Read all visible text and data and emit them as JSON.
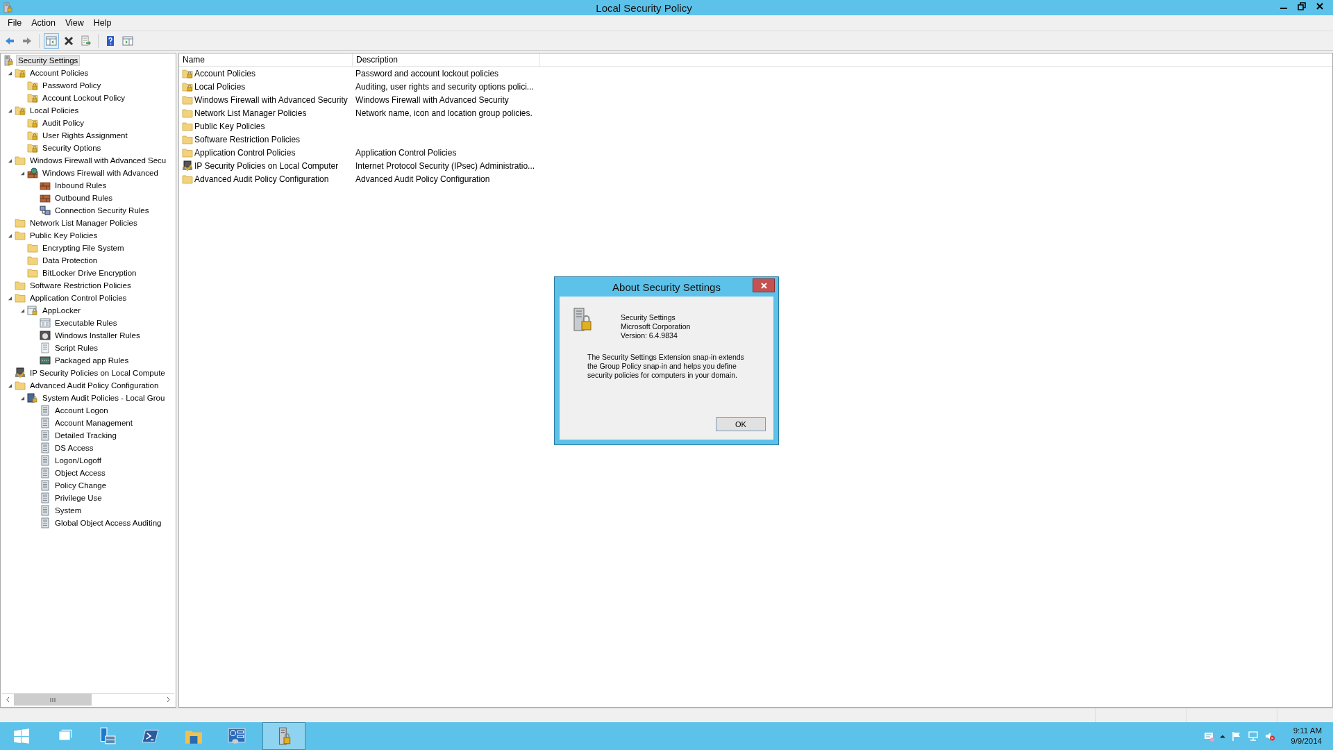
{
  "window": {
    "title": "Local Security Policy"
  },
  "menu": [
    "File",
    "Action",
    "View",
    "Help"
  ],
  "toolbar": [
    {
      "kind": "back"
    },
    {
      "kind": "forward"
    },
    {
      "kind": "pane",
      "selected": true
    },
    {
      "kind": "delete"
    },
    {
      "kind": "export"
    },
    {
      "kind": "help"
    },
    {
      "kind": "panel"
    }
  ],
  "tree": [
    {
      "label": "Security Settings",
      "kind": "root",
      "selected": true,
      "children": [
        {
          "label": "Account Policies",
          "kind": "lockfolder",
          "selected": false,
          "expanded": true,
          "children": [
            {
              "label": "Password Policy",
              "kind": "lockfolder",
              "selected": false
            },
            {
              "label": "Account Lockout Policy",
              "kind": "lockfolder",
              "selected": false
            }
          ]
        },
        {
          "label": "Local Policies",
          "kind": "lockfolder",
          "selected": false,
          "expanded": true,
          "children": [
            {
              "label": "Audit Policy",
              "kind": "lockfolder",
              "selected": false
            },
            {
              "label": "User Rights Assignment",
              "kind": "lockfolder",
              "selected": false
            },
            {
              "label": "Security Options",
              "kind": "lockfolder",
              "selected": false
            }
          ]
        },
        {
          "label": "Windows Firewall with Advanced Secu",
          "kind": "folder",
          "selected": false,
          "expanded": true,
          "children": [
            {
              "label": "Windows Firewall with Advanced",
              "kind": "firewall",
              "selected": false,
              "expanded": true,
              "children": [
                {
                  "label": "Inbound Rules",
                  "kind": "wall",
                  "selected": false
                },
                {
                  "label": "Outbound Rules",
                  "kind": "wall",
                  "selected": false
                },
                {
                  "label": "Connection Security Rules",
                  "kind": "connection",
                  "selected": false
                }
              ]
            }
          ]
        },
        {
          "label": "Network List Manager Policies",
          "kind": "folder",
          "selected": false
        },
        {
          "label": "Public Key Policies",
          "kind": "folder",
          "selected": false,
          "expanded": true,
          "children": [
            {
              "label": "Encrypting File System",
              "kind": "folder",
              "selected": false
            },
            {
              "label": "Data Protection",
              "kind": "folder",
              "selected": false
            },
            {
              "label": "BitLocker Drive Encryption",
              "kind": "folder",
              "selected": false
            }
          ]
        },
        {
          "label": "Software Restriction Policies",
          "kind": "folder",
          "selected": false
        },
        {
          "label": "Application Control Policies",
          "kind": "folder",
          "selected": false,
          "expanded": true,
          "children": [
            {
              "label": "AppLocker",
              "kind": "applocker",
              "selected": false,
              "expanded": true,
              "children": [
                {
                  "label": "Executable Rules",
                  "kind": "window",
                  "selected": false
                },
                {
                  "label": "Windows Installer Rules",
                  "kind": "installer",
                  "selected": false
                },
                {
                  "label": "Script Rules",
                  "kind": "script",
                  "selected": false
                },
                {
                  "label": "Packaged app Rules",
                  "kind": "package",
                  "selected": false
                }
              ]
            }
          ]
        },
        {
          "label": "IP Security Policies on Local Compute",
          "kind": "ipsec",
          "selected": false
        },
        {
          "label": "Advanced Audit Policy Configuration",
          "kind": "folder",
          "selected": false,
          "expanded": true,
          "children": [
            {
              "label": "System Audit Policies - Local Grou",
              "kind": "auditroot",
              "selected": false,
              "expanded": true,
              "children": [
                {
                  "label": "Account Logon",
                  "kind": "audit",
                  "selected": false
                },
                {
                  "label": "Account Management",
                  "kind": "audit",
                  "selected": false
                },
                {
                  "label": "Detailed Tracking",
                  "kind": "audit",
                  "selected": false
                },
                {
                  "label": "DS Access",
                  "kind": "audit",
                  "selected": false
                },
                {
                  "label": "Logon/Logoff",
                  "kind": "audit",
                  "selected": false
                },
                {
                  "label": "Object Access",
                  "kind": "audit",
                  "selected": false
                },
                {
                  "label": "Policy Change",
                  "kind": "audit",
                  "selected": false
                },
                {
                  "label": "Privilege Use",
                  "kind": "audit",
                  "selected": false
                },
                {
                  "label": "System",
                  "kind": "audit",
                  "selected": false
                },
                {
                  "label": "Global Object Access Auditing",
                  "kind": "audit",
                  "selected": false
                }
              ]
            }
          ]
        }
      ]
    }
  ],
  "table": {
    "columns": [
      "Name",
      "Description"
    ],
    "rows": [
      {
        "name": "Account Policies",
        "kind": "lockfolder",
        "description": "Password and account lockout policies"
      },
      {
        "name": "Local Policies",
        "kind": "lockfolder",
        "description": "Auditing, user rights and security options polici..."
      },
      {
        "name": "Windows Firewall with Advanced Security",
        "kind": "folder",
        "description": "Windows Firewall with Advanced Security"
      },
      {
        "name": "Network List Manager Policies",
        "kind": "folder",
        "description": "Network name, icon and location group policies."
      },
      {
        "name": "Public Key Policies",
        "kind": "folder"
      },
      {
        "name": "Software Restriction Policies",
        "kind": "folder"
      },
      {
        "name": "Application Control Policies",
        "kind": "folder",
        "description": "Application Control Policies"
      },
      {
        "name": "IP Security Policies on Local Computer",
        "kind": "ipsec",
        "description": "Internet Protocol Security (IPsec) Administratio..."
      },
      {
        "name": "Advanced Audit Policy Configuration",
        "kind": "folder",
        "description": "Advanced Audit Policy Configuration"
      }
    ]
  },
  "dialog": {
    "title": "About Security Settings",
    "product": "Security Settings",
    "company": "Microsoft Corporation",
    "version": "Version: 6.4.9834",
    "description": "The Security Settings Extension snap-in extends the Group Policy snap-in and helps you define security policies for computers in your domain.",
    "button": "OK"
  },
  "taskbar": {
    "apps": [
      {
        "kind": "start",
        "selected": false
      },
      {
        "kind": "taskview",
        "selected": false
      },
      {
        "kind": "servermanager",
        "selected": false
      },
      {
        "kind": "powershell",
        "selected": false
      },
      {
        "kind": "explorer",
        "selected": false
      },
      {
        "kind": "controlpanel",
        "selected": false
      },
      {
        "kind": "security",
        "selected": true
      }
    ],
    "tray": [
      {
        "kind": "notify"
      },
      {
        "kind": "chevron"
      },
      {
        "kind": "flag"
      },
      {
        "kind": "network"
      },
      {
        "kind": "volume"
      }
    ],
    "time": "9:11 AM",
    "date": "9/9/2014"
  }
}
